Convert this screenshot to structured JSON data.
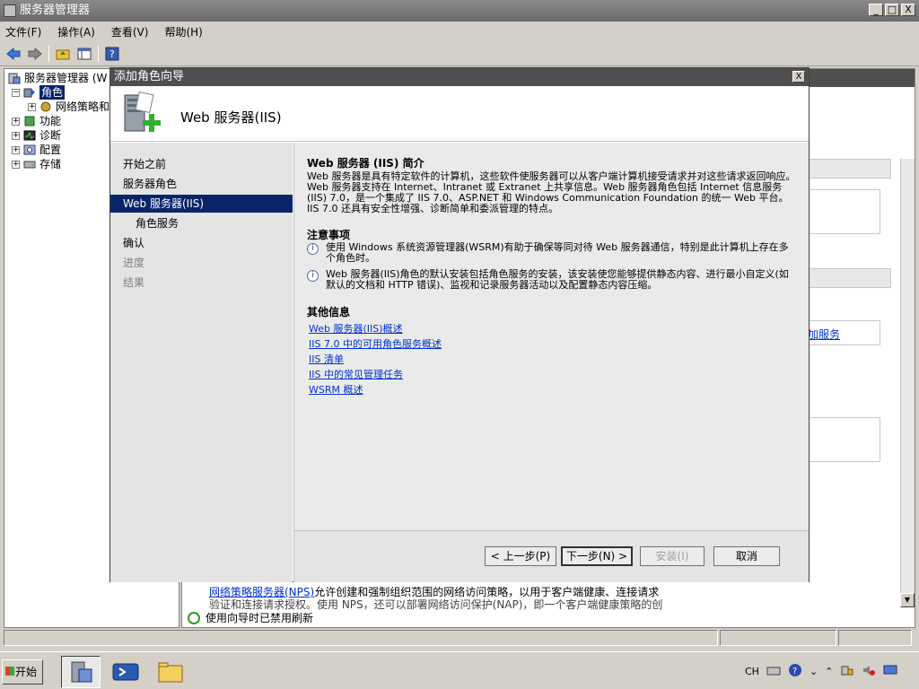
{
  "main_window": {
    "title": "服务器管理器",
    "min_label": "_",
    "max_label": "□",
    "close_label": "X"
  },
  "menu": [
    "文件(F)",
    "操作(A)",
    "查看(V)",
    "帮助(H)"
  ],
  "tree": {
    "root": "服务器管理器 (W",
    "roles": "角色",
    "nps": "网络策略和",
    "features": "功能",
    "diagnostics": "诊断",
    "config": "配置",
    "storage": "存储"
  },
  "right_pane": {
    "service_link": "加服务",
    "nps_link": "网络策略服务器(NPS)",
    "nps_text": "允许创建和强制组织范围的网络访问策略，以用于客户端健康、连接请求",
    "nps_text2": "验证和连接请求授权。使用 NPS，还可以部署网络访问保护(NAP)，即一个客户端健康策略的创",
    "refresh_status": "使用向导时已禁用刷新"
  },
  "dialog": {
    "title": "添加角色向导",
    "close_label": "X",
    "heading": "Web 服务器(IIS)",
    "nav": [
      {
        "label": "开始之前",
        "state": "normal"
      },
      {
        "label": "服务器角色",
        "state": "normal"
      },
      {
        "label": "Web 服务器(IIS)",
        "state": "active"
      },
      {
        "label": "角色服务",
        "state": "sub"
      },
      {
        "label": "确认",
        "state": "normal"
      },
      {
        "label": "进度",
        "state": "disabled"
      },
      {
        "label": "结果",
        "state": "disabled"
      }
    ],
    "intro_title": "Web 服务器 (IIS) 简介",
    "intro_text": "Web 服务器是具有特定软件的计算机，这些软件使服务器可以从客户端计算机接受请求并对这些请求返回响应。Web 服务器支持在 Internet、Intranet 或 Extranet 上共享信息。Web 服务器角色包括 Internet 信息服务(IIS) 7.0，是一个集成了 IIS 7.0、ASP.NET 和 Windows Communication Foundation 的统一 Web 平台。IIS 7.0 还具有安全性增强、诊断简单和委派管理的特点。",
    "notes_title": "注意事项",
    "notes": [
      "使用 Windows 系统资源管理器(WSRM)有助于确保等同对待 Web 服务器通信，特别是此计算机上存在多个角色时。",
      "Web 服务器(IIS)角色的默认安装包括角色服务的安装，该安装使您能够提供静态内容、进行最小自定义(如默认的文档和 HTTP 错误)、监视和记录服务器活动以及配置静态内容压缩。"
    ],
    "info_title": "其他信息",
    "links": [
      "Web 服务器(IIS)概述",
      "IIS 7.0 中的可用角色服务概述",
      "IIS 清单",
      "IIS 中的常见管理任务",
      "WSRM 概述"
    ],
    "buttons": {
      "back": "< 上一步(P)",
      "next": "下一步(N) >",
      "install": "安装(I)",
      "cancel": "取消"
    }
  },
  "taskbar": {
    "start": "开始",
    "lang": "CH"
  }
}
